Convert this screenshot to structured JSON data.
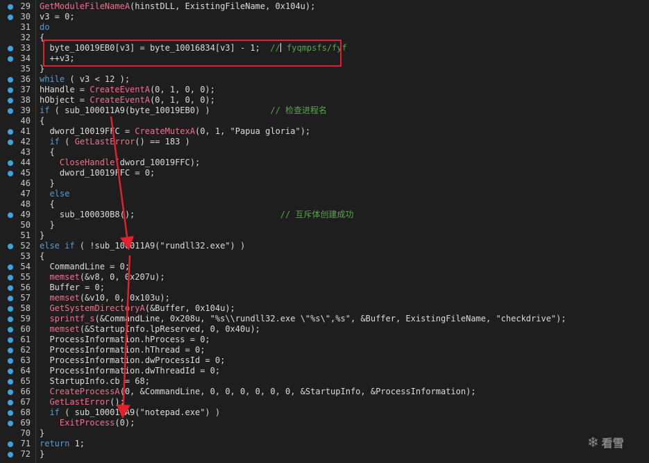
{
  "watermark": {
    "icon": "snowflake-icon",
    "text": "看雪"
  },
  "highlight_color": "#e3202c",
  "arrow_color": "#e3202c",
  "lines": [
    {
      "n": "29",
      "bp": true,
      "t": [
        [
          "fn",
          "GetModuleFileNameA"
        ],
        [
          "plain",
          "(hinstDLL, ExistingFileName, 0x104u);"
        ]
      ]
    },
    {
      "n": "30",
      "bp": true,
      "t": [
        [
          "plain",
          "v3 = 0;"
        ]
      ]
    },
    {
      "n": "31",
      "bp": false,
      "t": [
        [
          "kw",
          "do"
        ]
      ]
    },
    {
      "n": "32",
      "bp": false,
      "t": [
        [
          "plain",
          "{"
        ]
      ]
    },
    {
      "n": "33",
      "bp": true,
      "t": [
        [
          "plain",
          "  byte_10019EB0[v3] = byte_10016834[v3] - 1;  "
        ],
        [
          "cmt",
          "//"
        ],
        [
          "cursor",
          ""
        ],
        [
          "cmt",
          " fyqmpsfs/fyf"
        ]
      ]
    },
    {
      "n": "34",
      "bp": true,
      "t": [
        [
          "plain",
          "  ++v3;"
        ]
      ]
    },
    {
      "n": "35",
      "bp": false,
      "t": [
        [
          "plain",
          "}"
        ]
      ]
    },
    {
      "n": "36",
      "bp": true,
      "t": [
        [
          "kw",
          "while"
        ],
        [
          "plain",
          " ( v3 < 12 );"
        ]
      ]
    },
    {
      "n": "37",
      "bp": true,
      "t": [
        [
          "plain",
          "hHandle = "
        ],
        [
          "fn",
          "CreateEventA"
        ],
        [
          "plain",
          "(0, 1, 0, 0);"
        ]
      ]
    },
    {
      "n": "38",
      "bp": true,
      "t": [
        [
          "plain",
          "hObject = "
        ],
        [
          "fn",
          "CreateEventA"
        ],
        [
          "plain",
          "(0, 1, 0, 0);"
        ]
      ]
    },
    {
      "n": "39",
      "bp": true,
      "t": [
        [
          "kw",
          "if"
        ],
        [
          "plain",
          " ( sub_100011A9(byte_10019EB0) )            "
        ],
        [
          "cmt",
          "// 检查进程名"
        ]
      ]
    },
    {
      "n": "40",
      "bp": false,
      "t": [
        [
          "plain",
          "{"
        ]
      ]
    },
    {
      "n": "41",
      "bp": true,
      "t": [
        [
          "plain",
          "  dword_10019FFC = "
        ],
        [
          "fn",
          "CreateMutexA"
        ],
        [
          "plain",
          "(0, 1, \"Papua gloria\");"
        ]
      ]
    },
    {
      "n": "42",
      "bp": true,
      "t": [
        [
          "plain",
          "  "
        ],
        [
          "kw",
          "if"
        ],
        [
          "plain",
          " ( "
        ],
        [
          "fn",
          "GetLastError"
        ],
        [
          "plain",
          "() == 183 )"
        ]
      ]
    },
    {
      "n": "43",
      "bp": false,
      "t": [
        [
          "plain",
          "  {"
        ]
      ]
    },
    {
      "n": "44",
      "bp": true,
      "t": [
        [
          "plain",
          "    "
        ],
        [
          "fn",
          "CloseHandle"
        ],
        [
          "plain",
          "(dword_10019FFC);"
        ]
      ]
    },
    {
      "n": "45",
      "bp": true,
      "t": [
        [
          "plain",
          "    dword_10019FFC = 0;"
        ]
      ]
    },
    {
      "n": "46",
      "bp": false,
      "t": [
        [
          "plain",
          "  }"
        ]
      ]
    },
    {
      "n": "47",
      "bp": false,
      "t": [
        [
          "plain",
          "  "
        ],
        [
          "kw",
          "else"
        ]
      ]
    },
    {
      "n": "48",
      "bp": false,
      "t": [
        [
          "plain",
          "  {"
        ]
      ]
    },
    {
      "n": "49",
      "bp": true,
      "t": [
        [
          "plain",
          "    sub_100030B8();                             "
        ],
        [
          "cmt",
          "// 互斥体创建成功"
        ]
      ]
    },
    {
      "n": "50",
      "bp": false,
      "t": [
        [
          "plain",
          "  }"
        ]
      ]
    },
    {
      "n": "51",
      "bp": false,
      "t": [
        [
          "plain",
          "}"
        ]
      ]
    },
    {
      "n": "52",
      "bp": true,
      "t": [
        [
          "kw",
          "else if"
        ],
        [
          "plain",
          " ( !sub_100011A9(\"rundll32.exe\") )"
        ]
      ]
    },
    {
      "n": "53",
      "bp": false,
      "t": [
        [
          "plain",
          "{"
        ]
      ]
    },
    {
      "n": "54",
      "bp": true,
      "t": [
        [
          "plain",
          "  CommandLine = 0;"
        ]
      ]
    },
    {
      "n": "55",
      "bp": true,
      "t": [
        [
          "plain",
          "  "
        ],
        [
          "fn",
          "memset"
        ],
        [
          "plain",
          "(&v8, 0, 0x207u);"
        ]
      ]
    },
    {
      "n": "56",
      "bp": true,
      "t": [
        [
          "plain",
          "  Buffer = 0;"
        ]
      ]
    },
    {
      "n": "57",
      "bp": true,
      "t": [
        [
          "plain",
          "  "
        ],
        [
          "fn",
          "memset"
        ],
        [
          "plain",
          "(&v10, 0, 0x103u);"
        ]
      ]
    },
    {
      "n": "58",
      "bp": true,
      "t": [
        [
          "plain",
          "  "
        ],
        [
          "fn",
          "GetSystemDirectoryA"
        ],
        [
          "plain",
          "(&Buffer, 0x104u);"
        ]
      ]
    },
    {
      "n": "59",
      "bp": true,
      "t": [
        [
          "plain",
          "  "
        ],
        [
          "fn",
          "sprintf_s"
        ],
        [
          "plain",
          "(&CommandLine, 0x208u, \"%s\\\\rundll32.exe \\\"%s\\\",%s\", &Buffer, ExistingFileName, \"checkdrive\");"
        ]
      ]
    },
    {
      "n": "60",
      "bp": true,
      "t": [
        [
          "plain",
          "  "
        ],
        [
          "fn",
          "memset"
        ],
        [
          "plain",
          "(&StartupInfo.lpReserved, 0, 0x40u);"
        ]
      ]
    },
    {
      "n": "61",
      "bp": true,
      "t": [
        [
          "plain",
          "  ProcessInformation.hProcess = 0;"
        ]
      ]
    },
    {
      "n": "62",
      "bp": true,
      "t": [
        [
          "plain",
          "  ProcessInformation.hThread = 0;"
        ]
      ]
    },
    {
      "n": "63",
      "bp": true,
      "t": [
        [
          "plain",
          "  ProcessInformation.dwProcessId = 0;"
        ]
      ]
    },
    {
      "n": "64",
      "bp": true,
      "t": [
        [
          "plain",
          "  ProcessInformation.dwThreadId = 0;"
        ]
      ]
    },
    {
      "n": "65",
      "bp": true,
      "t": [
        [
          "plain",
          "  StartupInfo.cb = 68;"
        ]
      ]
    },
    {
      "n": "66",
      "bp": true,
      "t": [
        [
          "plain",
          "  "
        ],
        [
          "fn",
          "CreateProcessA"
        ],
        [
          "plain",
          "(0, &CommandLine, 0, 0, 0, 0, 0, 0, &StartupInfo, &ProcessInformation);"
        ]
      ]
    },
    {
      "n": "67",
      "bp": true,
      "t": [
        [
          "plain",
          "  "
        ],
        [
          "fn",
          "GetLastError"
        ],
        [
          "plain",
          "();"
        ]
      ]
    },
    {
      "n": "68",
      "bp": true,
      "t": [
        [
          "plain",
          "  "
        ],
        [
          "kw",
          "if"
        ],
        [
          "plain",
          " ( sub_100011A9(\"notepad.exe\") )"
        ]
      ]
    },
    {
      "n": "69",
      "bp": true,
      "t": [
        [
          "plain",
          "    "
        ],
        [
          "fn",
          "ExitProcess"
        ],
        [
          "plain",
          "(0);"
        ]
      ]
    },
    {
      "n": "70",
      "bp": false,
      "t": [
        [
          "plain",
          "}"
        ]
      ]
    },
    {
      "n": "71",
      "bp": true,
      "t": [
        [
          "kw",
          "return"
        ],
        [
          "plain",
          " 1;"
        ]
      ]
    },
    {
      "n": "72",
      "bp": true,
      "t": [
        [
          "plain",
          "}"
        ]
      ]
    }
  ]
}
